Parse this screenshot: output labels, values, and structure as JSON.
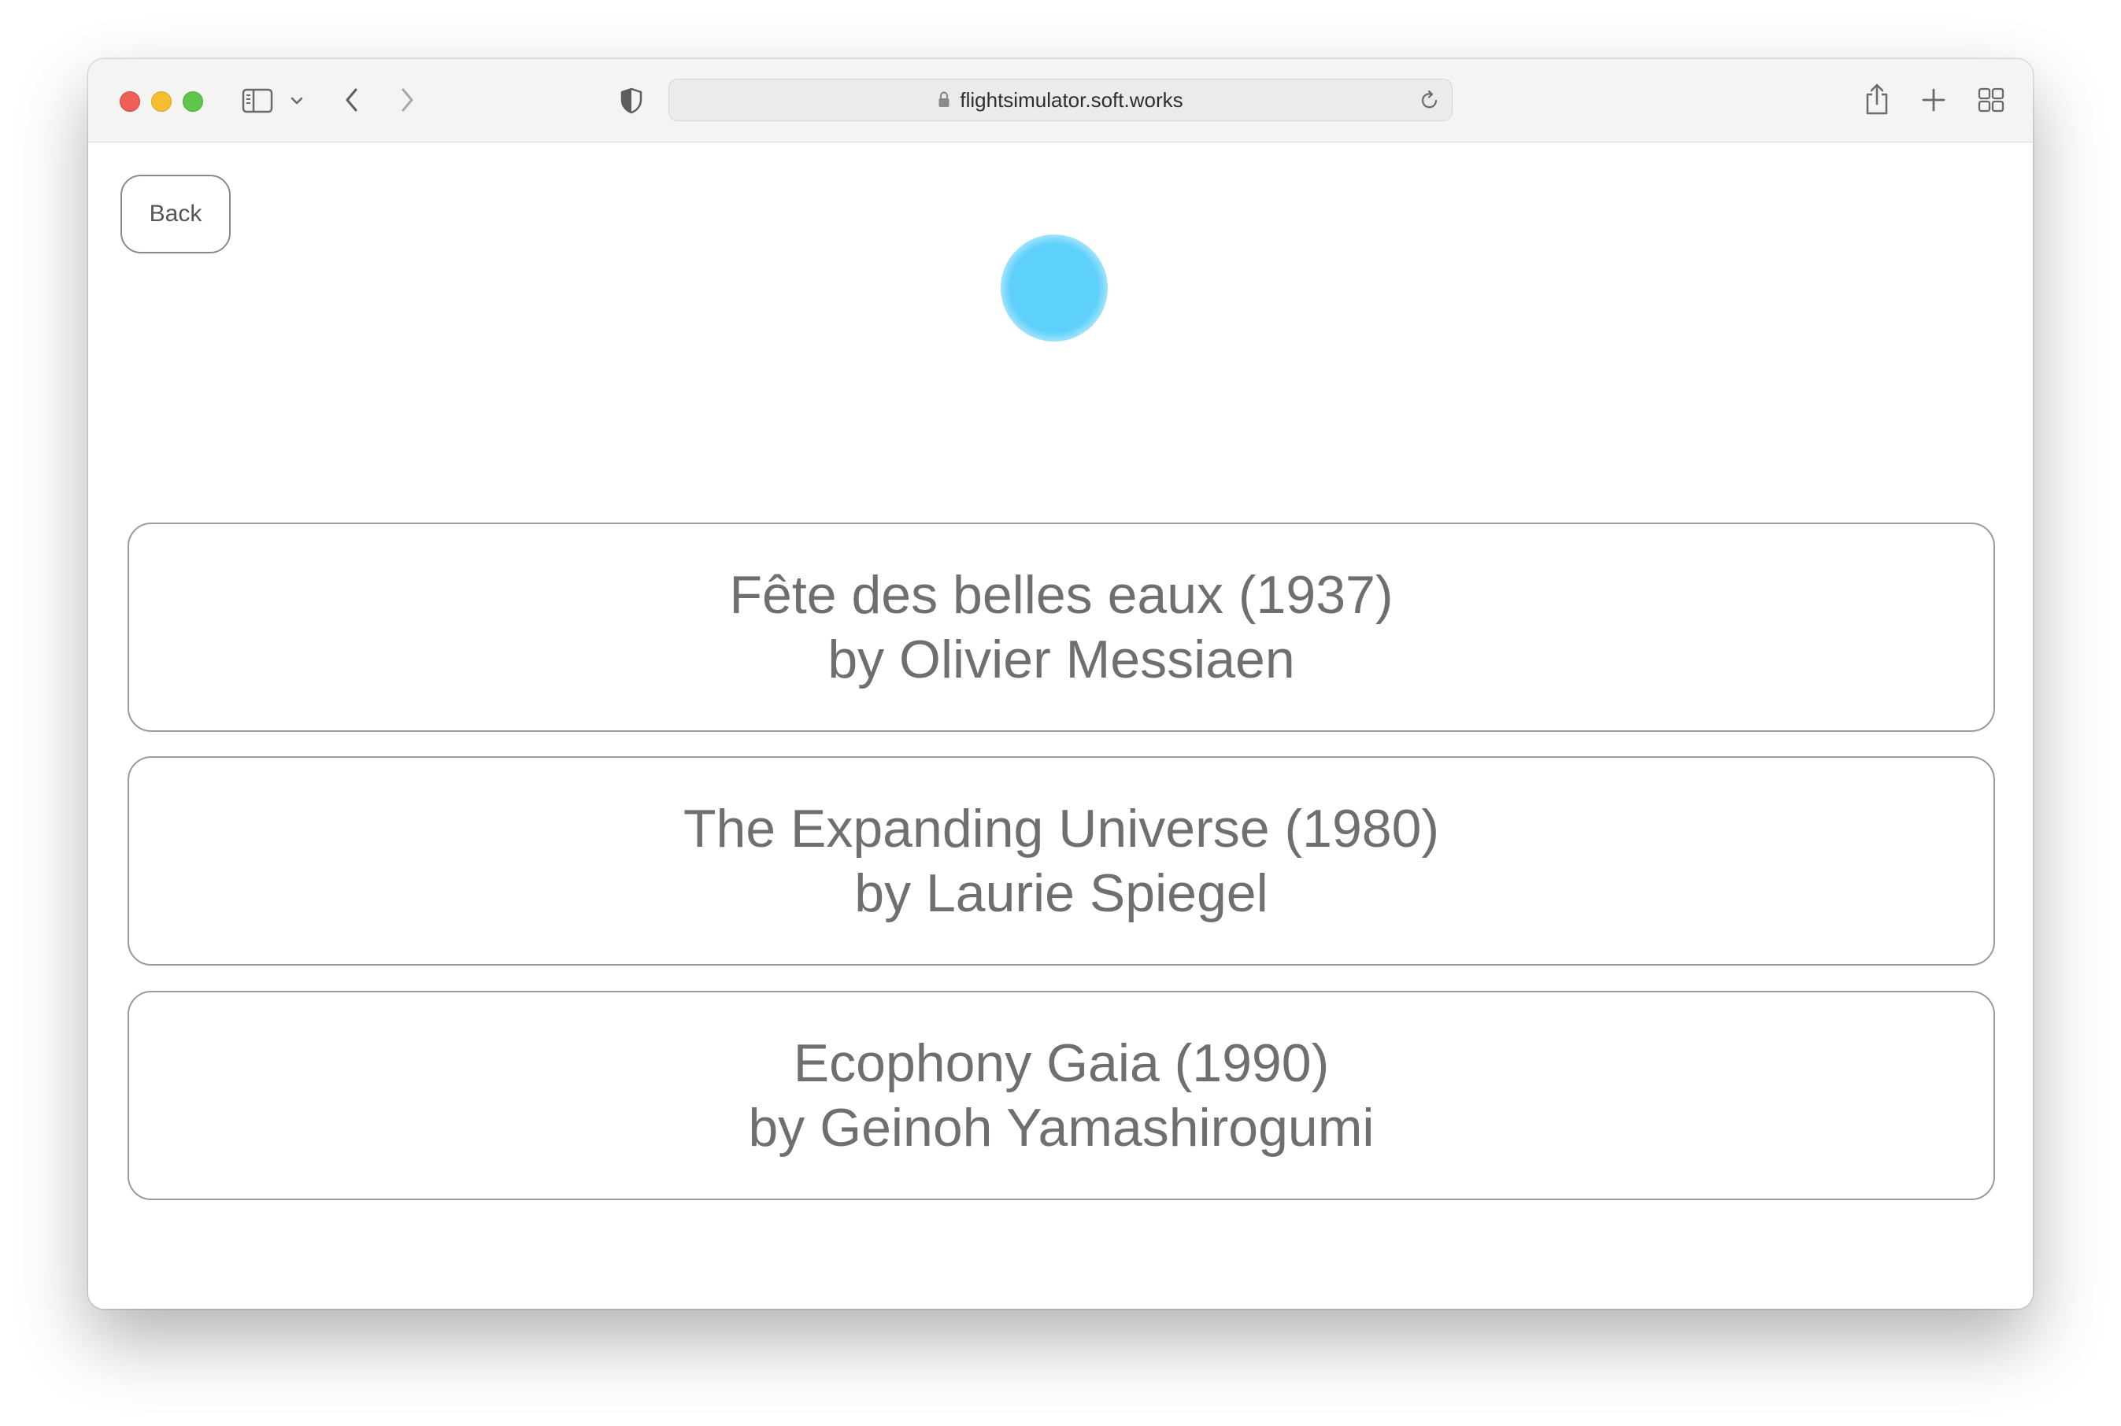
{
  "browser": {
    "url": "flightsimulator.soft.works",
    "icons": {
      "sidebar": "sidebar-icon",
      "sidebar_menu": "chevron-down-icon",
      "back": "chevron-left-icon",
      "forward": "chevron-right-icon",
      "privacy": "shield-icon",
      "lock": "lock-icon",
      "reload": "reload-icon",
      "share": "share-icon",
      "new_tab": "plus-icon",
      "tab_overview": "grid-icon"
    }
  },
  "page": {
    "back_label": "Back",
    "orb_color": "#5DD0FB",
    "tracks": [
      {
        "title": "Fête des belles eaux (1937)",
        "artist": "by Olivier Messiaen"
      },
      {
        "title": "The Expanding Universe (1980)",
        "artist": "by Laurie Spiegel"
      },
      {
        "title": "Ecophony Gaia (1990)",
        "artist": "by Geinoh Yamashirogumi"
      }
    ]
  }
}
